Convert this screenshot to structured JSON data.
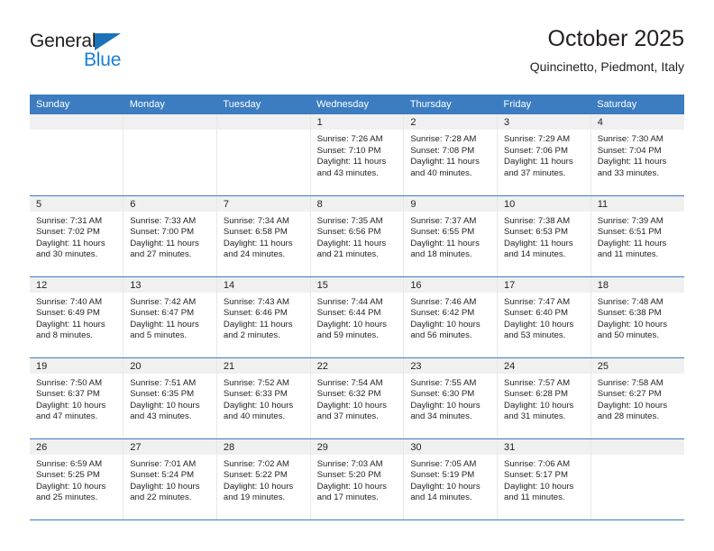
{
  "brand": {
    "word_top": "General",
    "word_bottom": "Blue",
    "triangle_color": "#1b72b8",
    "blue_text_color": "#1b7fd4",
    "top_text_color": "#231f20"
  },
  "header": {
    "title": "October 2025",
    "subtitle": "Quincinetto, Piedmont, Italy"
  },
  "theme": {
    "header_row_bg": "#3b7dc0",
    "header_row_text": "#ffffff",
    "daynum_bg": "#f0f0f0",
    "cell_bg": "#ffffff",
    "row_separator": "#3b7dc0",
    "column_separator": "#e8e8e8"
  },
  "weekday_headers": [
    "Sunday",
    "Monday",
    "Tuesday",
    "Wednesday",
    "Thursday",
    "Friday",
    "Saturday"
  ],
  "labels": {
    "sunrise_prefix": "Sunrise:",
    "sunset_prefix": "Sunset:",
    "daylight_prefix": "Daylight:"
  },
  "weeks": [
    [
      {
        "date": "",
        "empty": true,
        "lines": []
      },
      {
        "date": "",
        "empty": true,
        "lines": []
      },
      {
        "date": "",
        "empty": true,
        "lines": []
      },
      {
        "date": "1",
        "empty": false,
        "lines": [
          "Sunrise: 7:26 AM",
          "Sunset: 7:10 PM",
          "Daylight: 11 hours and 43 minutes."
        ]
      },
      {
        "date": "2",
        "empty": false,
        "lines": [
          "Sunrise: 7:28 AM",
          "Sunset: 7:08 PM",
          "Daylight: 11 hours and 40 minutes."
        ]
      },
      {
        "date": "3",
        "empty": false,
        "lines": [
          "Sunrise: 7:29 AM",
          "Sunset: 7:06 PM",
          "Daylight: 11 hours and 37 minutes."
        ]
      },
      {
        "date": "4",
        "empty": false,
        "lines": [
          "Sunrise: 7:30 AM",
          "Sunset: 7:04 PM",
          "Daylight: 11 hours and 33 minutes."
        ]
      }
    ],
    [
      {
        "date": "5",
        "empty": false,
        "lines": [
          "Sunrise: 7:31 AM",
          "Sunset: 7:02 PM",
          "Daylight: 11 hours and 30 minutes."
        ]
      },
      {
        "date": "6",
        "empty": false,
        "lines": [
          "Sunrise: 7:33 AM",
          "Sunset: 7:00 PM",
          "Daylight: 11 hours and 27 minutes."
        ]
      },
      {
        "date": "7",
        "empty": false,
        "lines": [
          "Sunrise: 7:34 AM",
          "Sunset: 6:58 PM",
          "Daylight: 11 hours and 24 minutes."
        ]
      },
      {
        "date": "8",
        "empty": false,
        "lines": [
          "Sunrise: 7:35 AM",
          "Sunset: 6:56 PM",
          "Daylight: 11 hours and 21 minutes."
        ]
      },
      {
        "date": "9",
        "empty": false,
        "lines": [
          "Sunrise: 7:37 AM",
          "Sunset: 6:55 PM",
          "Daylight: 11 hours and 18 minutes."
        ]
      },
      {
        "date": "10",
        "empty": false,
        "lines": [
          "Sunrise: 7:38 AM",
          "Sunset: 6:53 PM",
          "Daylight: 11 hours and 14 minutes."
        ]
      },
      {
        "date": "11",
        "empty": false,
        "lines": [
          "Sunrise: 7:39 AM",
          "Sunset: 6:51 PM",
          "Daylight: 11 hours and 11 minutes."
        ]
      }
    ],
    [
      {
        "date": "12",
        "empty": false,
        "lines": [
          "Sunrise: 7:40 AM",
          "Sunset: 6:49 PM",
          "Daylight: 11 hours and 8 minutes."
        ]
      },
      {
        "date": "13",
        "empty": false,
        "lines": [
          "Sunrise: 7:42 AM",
          "Sunset: 6:47 PM",
          "Daylight: 11 hours and 5 minutes."
        ]
      },
      {
        "date": "14",
        "empty": false,
        "lines": [
          "Sunrise: 7:43 AM",
          "Sunset: 6:46 PM",
          "Daylight: 11 hours and 2 minutes."
        ]
      },
      {
        "date": "15",
        "empty": false,
        "lines": [
          "Sunrise: 7:44 AM",
          "Sunset: 6:44 PM",
          "Daylight: 10 hours and 59 minutes."
        ]
      },
      {
        "date": "16",
        "empty": false,
        "lines": [
          "Sunrise: 7:46 AM",
          "Sunset: 6:42 PM",
          "Daylight: 10 hours and 56 minutes."
        ]
      },
      {
        "date": "17",
        "empty": false,
        "lines": [
          "Sunrise: 7:47 AM",
          "Sunset: 6:40 PM",
          "Daylight: 10 hours and 53 minutes."
        ]
      },
      {
        "date": "18",
        "empty": false,
        "lines": [
          "Sunrise: 7:48 AM",
          "Sunset: 6:38 PM",
          "Daylight: 10 hours and 50 minutes."
        ]
      }
    ],
    [
      {
        "date": "19",
        "empty": false,
        "lines": [
          "Sunrise: 7:50 AM",
          "Sunset: 6:37 PM",
          "Daylight: 10 hours and 47 minutes."
        ]
      },
      {
        "date": "20",
        "empty": false,
        "lines": [
          "Sunrise: 7:51 AM",
          "Sunset: 6:35 PM",
          "Daylight: 10 hours and 43 minutes."
        ]
      },
      {
        "date": "21",
        "empty": false,
        "lines": [
          "Sunrise: 7:52 AM",
          "Sunset: 6:33 PM",
          "Daylight: 10 hours and 40 minutes."
        ]
      },
      {
        "date": "22",
        "empty": false,
        "lines": [
          "Sunrise: 7:54 AM",
          "Sunset: 6:32 PM",
          "Daylight: 10 hours and 37 minutes."
        ]
      },
      {
        "date": "23",
        "empty": false,
        "lines": [
          "Sunrise: 7:55 AM",
          "Sunset: 6:30 PM",
          "Daylight: 10 hours and 34 minutes."
        ]
      },
      {
        "date": "24",
        "empty": false,
        "lines": [
          "Sunrise: 7:57 AM",
          "Sunset: 6:28 PM",
          "Daylight: 10 hours and 31 minutes."
        ]
      },
      {
        "date": "25",
        "empty": false,
        "lines": [
          "Sunrise: 7:58 AM",
          "Sunset: 6:27 PM",
          "Daylight: 10 hours and 28 minutes."
        ]
      }
    ],
    [
      {
        "date": "26",
        "empty": false,
        "lines": [
          "Sunrise: 6:59 AM",
          "Sunset: 5:25 PM",
          "Daylight: 10 hours and 25 minutes."
        ]
      },
      {
        "date": "27",
        "empty": false,
        "lines": [
          "Sunrise: 7:01 AM",
          "Sunset: 5:24 PM",
          "Daylight: 10 hours and 22 minutes."
        ]
      },
      {
        "date": "28",
        "empty": false,
        "lines": [
          "Sunrise: 7:02 AM",
          "Sunset: 5:22 PM",
          "Daylight: 10 hours and 19 minutes."
        ]
      },
      {
        "date": "29",
        "empty": false,
        "lines": [
          "Sunrise: 7:03 AM",
          "Sunset: 5:20 PM",
          "Daylight: 10 hours and 17 minutes."
        ]
      },
      {
        "date": "30",
        "empty": false,
        "lines": [
          "Sunrise: 7:05 AM",
          "Sunset: 5:19 PM",
          "Daylight: 10 hours and 14 minutes."
        ]
      },
      {
        "date": "31",
        "empty": false,
        "lines": [
          "Sunrise: 7:06 AM",
          "Sunset: 5:17 PM",
          "Daylight: 10 hours and 11 minutes."
        ]
      },
      {
        "date": "",
        "empty": true,
        "lines": []
      }
    ]
  ]
}
